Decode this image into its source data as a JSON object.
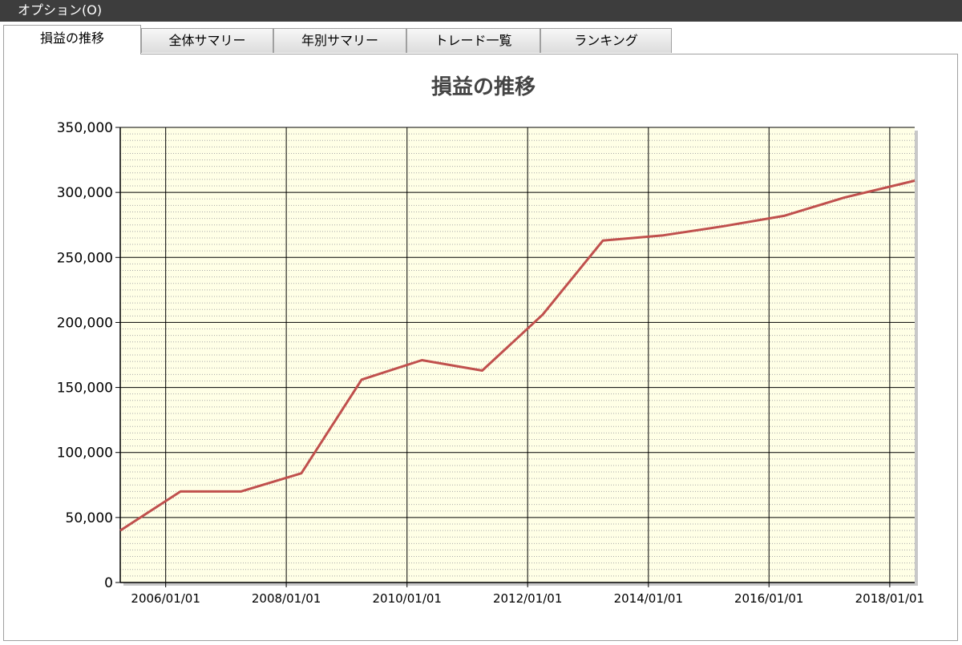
{
  "menu": {
    "options_label": "オプション(O)"
  },
  "tabs": [
    {
      "label": "損益の推移",
      "active": true
    },
    {
      "label": "全体サマリー",
      "active": false
    },
    {
      "label": "年別サマリー",
      "active": false
    },
    {
      "label": "トレード一覧",
      "active": false
    },
    {
      "label": "ランキング",
      "active": false
    }
  ],
  "colors": {
    "plot_background": "#ffffe6",
    "line": "#c0504d",
    "major_grid": "#000000",
    "minor_grid": "#a9a9a9"
  },
  "chart_data": {
    "type": "line",
    "title": "損益の推移",
    "xlabel": "",
    "ylabel": "",
    "x_axis_type": "date",
    "xlim": [
      "2005/04/01",
      "2018/06/01"
    ],
    "ylim": [
      0,
      350000
    ],
    "x_ticks": [
      "2006/01/01",
      "2008/01/01",
      "2010/01/01",
      "2012/01/01",
      "2014/01/01",
      "2016/01/01",
      "2018/01/01"
    ],
    "y_ticks": [
      0,
      50000,
      100000,
      150000,
      200000,
      250000,
      300000,
      350000
    ],
    "y_tick_labels": [
      "0",
      "50,000",
      "100,000",
      "150,000",
      "200,000",
      "250,000",
      "300,000",
      "350,000"
    ],
    "y_minor_interval": 5000,
    "grid": true,
    "legend": "none",
    "series": [
      {
        "x": [
          "2005/04/01",
          "2006/04/01",
          "2007/04/01",
          "2008/04/01",
          "2009/04/01",
          "2010/04/01",
          "2011/04/01",
          "2012/04/01",
          "2013/04/01",
          "2014/04/01",
          "2015/04/01",
          "2016/04/01",
          "2017/04/01",
          "2018/06/01"
        ],
        "y": [
          40000,
          70000,
          70000,
          84000,
          156000,
          171000,
          163000,
          206000,
          263000,
          267000,
          274000,
          282000,
          296000,
          309000
        ]
      }
    ]
  }
}
